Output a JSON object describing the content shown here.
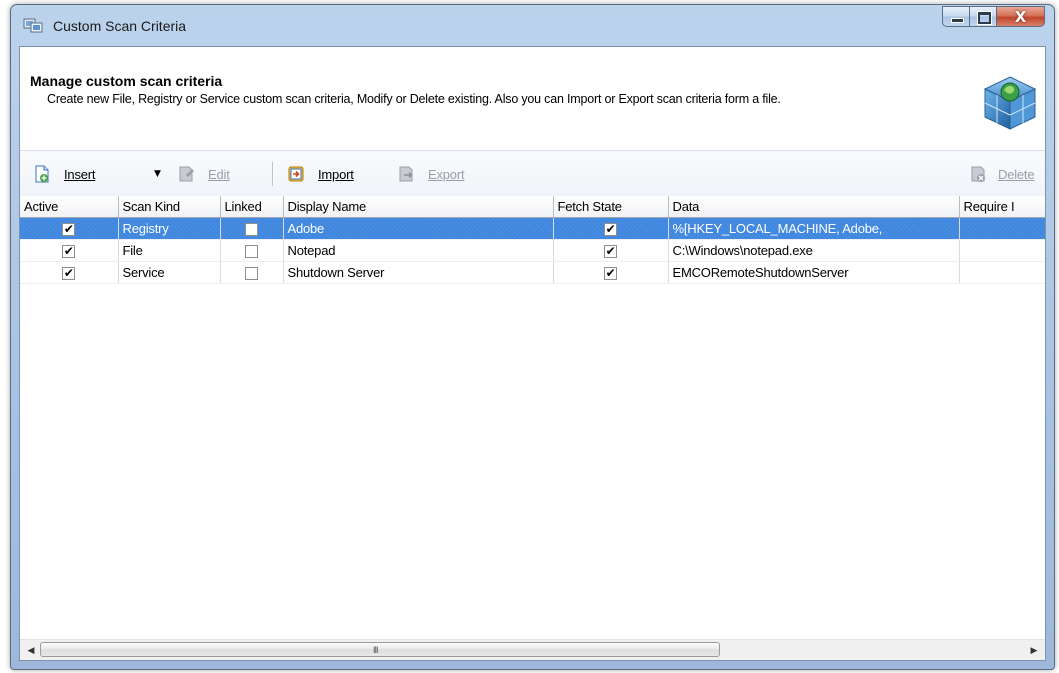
{
  "window": {
    "title": "Custom Scan Criteria"
  },
  "header": {
    "title": "Manage custom scan criteria",
    "description": "Create new File, Registry or Service custom scan criteria, Modify or Delete existing. Also you can Import or Export scan criteria form a file."
  },
  "toolbar": {
    "insert": {
      "label": "Insert",
      "icon": "insert-document-icon"
    },
    "edit": {
      "label": "Edit",
      "icon": "edit-icon",
      "enabled": false
    },
    "import": {
      "label": "Import",
      "icon": "import-icon"
    },
    "export": {
      "label": "Export",
      "icon": "export-icon",
      "enabled": false
    },
    "delete": {
      "label": "Delete",
      "icon": "delete-icon",
      "enabled": false
    }
  },
  "table": {
    "columns": [
      "Active",
      "Scan Kind",
      "Linked",
      "Display Name",
      "Fetch State",
      "Data",
      "Require I"
    ],
    "rows": [
      {
        "active": true,
        "scan_kind": "Registry",
        "linked": false,
        "display_name": "Adobe",
        "fetch_state": true,
        "data": "%[HKEY_LOCAL_MACHINE, Adobe,",
        "selected": true
      },
      {
        "active": true,
        "scan_kind": "File",
        "linked": false,
        "display_name": "Notepad",
        "fetch_state": true,
        "data": "C:\\Windows\\notepad.exe",
        "selected": false
      },
      {
        "active": true,
        "scan_kind": "Service",
        "linked": false,
        "display_name": "Shutdown Server",
        "fetch_state": true,
        "data": "EMCORemoteShutdownServer",
        "selected": false
      }
    ]
  },
  "scrollbar": {
    "grip": "III"
  },
  "colors": {
    "selection": "#3e86de",
    "titlebar": "#b2cbe8",
    "close_button": "#c7503a"
  }
}
